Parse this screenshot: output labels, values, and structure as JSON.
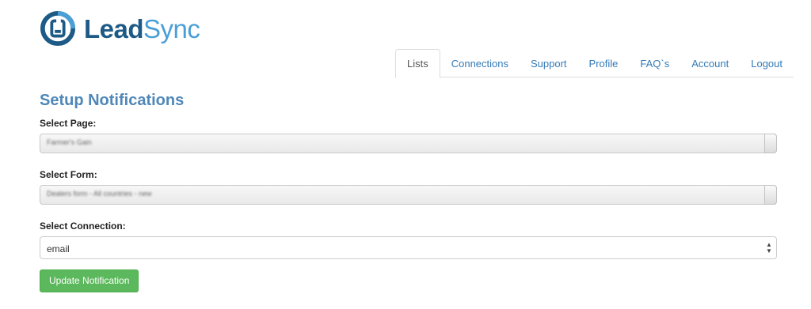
{
  "logo": {
    "lead": "Lead",
    "sync": "Sync",
    "icon": "leadsync-logo-icon",
    "color_dark": "#1d5a86",
    "color_light": "#4a9fd6"
  },
  "nav": {
    "tabs": [
      {
        "label": "Lists",
        "active": true
      },
      {
        "label": "Connections",
        "active": false
      },
      {
        "label": "Support",
        "active": false
      },
      {
        "label": "Profile",
        "active": false
      },
      {
        "label": "FAQ`s",
        "active": false
      },
      {
        "label": "Account",
        "active": false
      },
      {
        "label": "Logout",
        "active": false
      }
    ]
  },
  "main": {
    "title": "Setup Notifications",
    "select_page": {
      "label": "Select Page:",
      "value": "Farmer's Gain"
    },
    "select_form": {
      "label": "Select Form:",
      "value": "Dealers form - All countries - new"
    },
    "select_connection": {
      "label": "Select Connection:",
      "value": "email"
    },
    "update_button": "Update Notification"
  },
  "colors": {
    "accent": "#337ab7",
    "title": "#4f87b8",
    "button": "#5cb85c"
  }
}
